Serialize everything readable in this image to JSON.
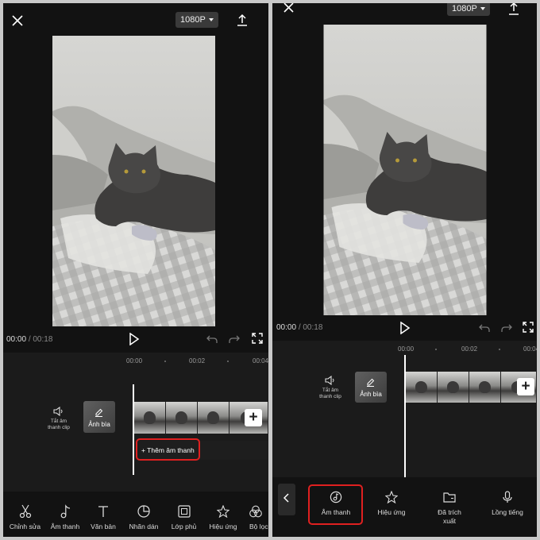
{
  "left": {
    "resolution": "1080P",
    "current_time": "00:00",
    "time_separator": "/",
    "total_time": "00:18",
    "ticks": [
      "00:00",
      "00:02",
      "00:04"
    ],
    "mute_label_line1": "Tắt âm",
    "mute_label_line2": "thanh clip",
    "cover_label": "Ảnh bìa",
    "add_audio_label": "+ Thêm âm thanh",
    "toolbar": [
      "Chỉnh sửa",
      "Âm thanh",
      "Văn bản",
      "Nhãn dán",
      "Lớp phủ",
      "Hiệu ứng",
      "Bộ lọc"
    ]
  },
  "right": {
    "resolution": "1080P",
    "current_time": "00:00",
    "time_separator": "/",
    "total_time": "00:18",
    "ticks": [
      "00:00",
      "00:02",
      "00:04"
    ],
    "mute_label_line1": "Tắt âm",
    "mute_label_line2": "thanh clip",
    "cover_label": "Ảnh bìa",
    "toolbar": [
      "Âm thanh",
      "Hiệu ứng",
      "Đã trích\nxuất",
      "Lồng tiếng"
    ]
  },
  "colors": {
    "background": "#121212",
    "timeline": "#1b1b1b",
    "highlight": "#e02020"
  },
  "icons": [
    "close-icon",
    "upload-icon",
    "play-icon",
    "undo-icon",
    "redo-icon",
    "fullscreen-icon",
    "speaker-icon",
    "pencil-icon",
    "scissors-icon",
    "music-note-icon",
    "text-icon",
    "sticker-icon",
    "overlay-icon",
    "effects-star-icon",
    "filter-icon",
    "back-chevron-icon",
    "extracted-folder-icon",
    "microphone-icon"
  ]
}
